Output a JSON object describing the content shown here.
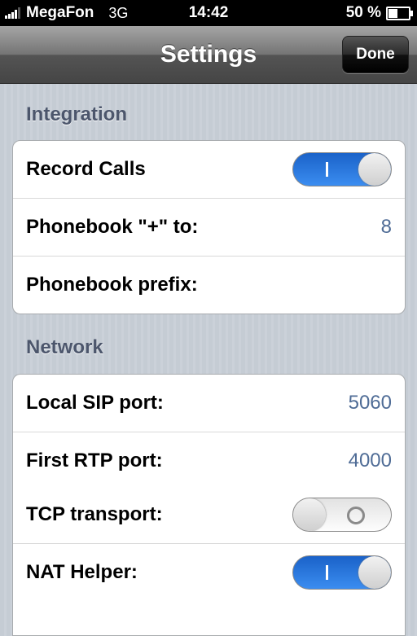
{
  "status_bar": {
    "carrier": "MegaFon",
    "network": "3G",
    "time": "14:42",
    "battery": "50 %"
  },
  "nav": {
    "title": "Settings",
    "done_label": "Done"
  },
  "sections": {
    "integration": {
      "header": "Integration",
      "record_calls": {
        "label": "Record Calls",
        "on": true
      },
      "phonebook_plus": {
        "label": "Phonebook \"+\" to:",
        "value": "8"
      },
      "phonebook_prefix": {
        "label": "Phonebook prefix:",
        "value": ""
      }
    },
    "network": {
      "header": "Network",
      "local_sip_port": {
        "label": "Local SIP port:",
        "value": "5060"
      },
      "first_rtp_port": {
        "label": "First RTP port:",
        "value": "4000"
      },
      "tcp_transport": {
        "label": "TCP transport:",
        "on": false
      },
      "nat_helper": {
        "label": "NAT Helper:",
        "on": true
      }
    }
  },
  "colors": {
    "accent_blue": "#2a7ae2",
    "value_text": "#4f6c96",
    "section_header": "#4c566c"
  }
}
